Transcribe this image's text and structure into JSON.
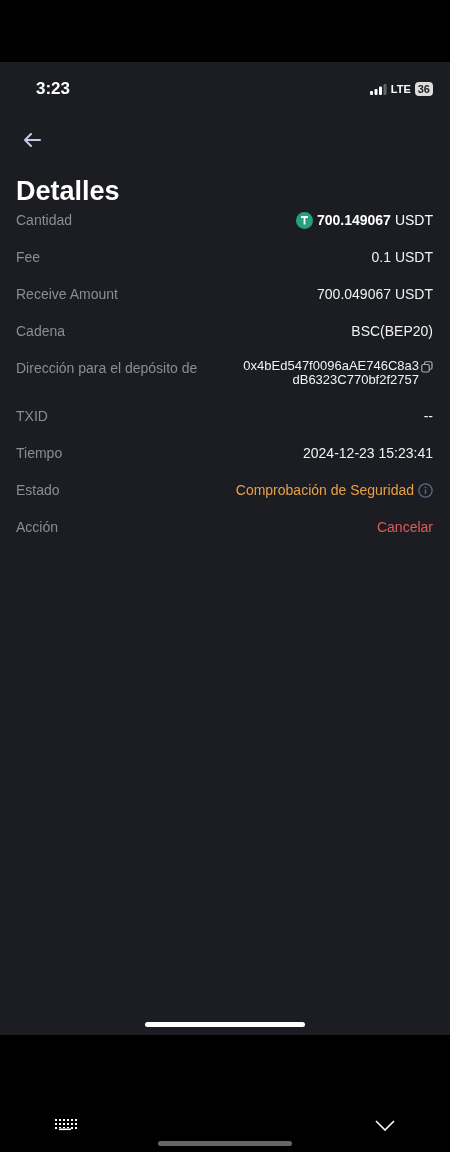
{
  "status_bar": {
    "time": "3:23",
    "network": "LTE",
    "battery": "36"
  },
  "title": "Detalles",
  "rows": [
    {
      "kind": "amount",
      "label": "Cantidad",
      "value": "700.149067",
      "unit": "USDT"
    },
    {
      "kind": "text",
      "label": "Fee",
      "value": "0.1 USDT"
    },
    {
      "kind": "text",
      "label": "Receive Amount",
      "value": "700.049067 USDT"
    },
    {
      "kind": "text",
      "label": "Cadena",
      "value": "BSC(BEP20)"
    },
    {
      "kind": "address",
      "label": "Dirección para el depósito de",
      "lines": [
        "0x4bEd547f0096aAE746C8a3",
        "dB6323C770bf2f2757"
      ]
    },
    {
      "kind": "text",
      "label": "TXID",
      "value": "--"
    },
    {
      "kind": "text",
      "label": "Tiempo",
      "value": "2024-12-23 15:23:41"
    },
    {
      "kind": "status",
      "label": "Estado",
      "value": "Comprobación de Seguridad"
    },
    {
      "kind": "action",
      "label": "Acción",
      "value": "Cancelar"
    }
  ]
}
